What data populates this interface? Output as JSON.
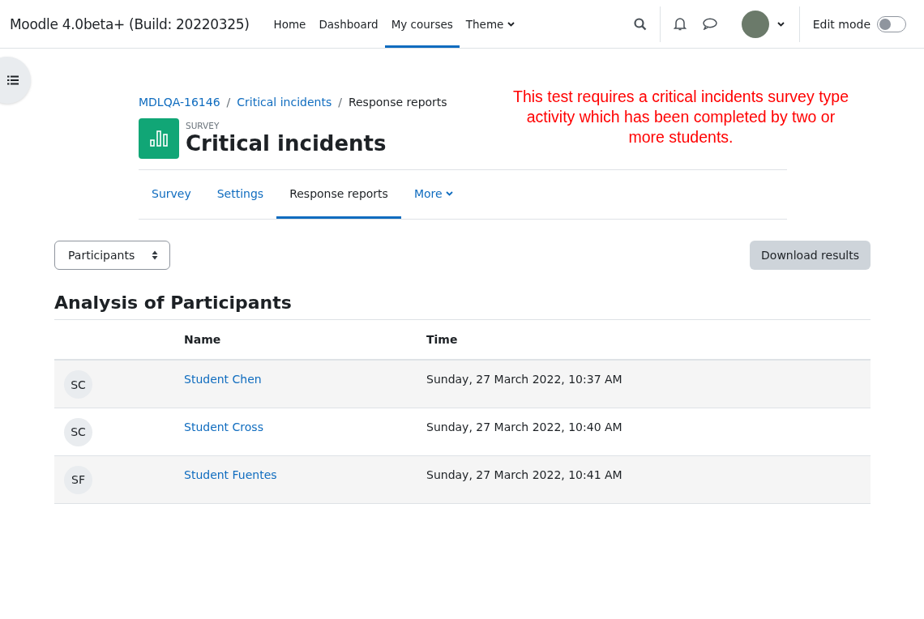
{
  "navbar": {
    "site_name": "Moodle 4.0beta+ (Build: 20220325)",
    "items": [
      {
        "label": "Home",
        "selected": false,
        "dropdown": false
      },
      {
        "label": "Dashboard",
        "selected": false,
        "dropdown": false
      },
      {
        "label": "My courses",
        "selected": true,
        "dropdown": false
      },
      {
        "label": "Theme",
        "selected": false,
        "dropdown": true
      }
    ],
    "edit_mode": {
      "label": "Edit mode",
      "on": false
    }
  },
  "note": "This test requires a critical incidents survey type activity which has been completed by two or more students.",
  "breadcrumb": [
    {
      "kind": "link",
      "label": "MDLQA-16146"
    },
    {
      "kind": "separator",
      "label": "/"
    },
    {
      "kind": "link",
      "label": "Critical incidents"
    },
    {
      "kind": "separator",
      "label": "/"
    },
    {
      "kind": "current",
      "label": "Response reports"
    }
  ],
  "activity": {
    "type_label": "SURVEY",
    "title": "Critical incidents"
  },
  "tabs": [
    {
      "label": "Survey",
      "selected": false,
      "dropdown": false
    },
    {
      "label": "Settings",
      "selected": false,
      "dropdown": false
    },
    {
      "label": "Response reports",
      "selected": true,
      "dropdown": false
    },
    {
      "label": "More",
      "selected": false,
      "dropdown": true
    }
  ],
  "report_select": {
    "value": "Participants"
  },
  "download_button": "Download results",
  "section_title": "Analysis of Participants",
  "table": {
    "columns": [
      "Name",
      "Time"
    ],
    "rows": [
      {
        "initials": "SC",
        "name": "Student Chen",
        "time": "Sunday, 27 March 2022, 10:37 AM"
      },
      {
        "initials": "SC",
        "name": "Student Cross",
        "time": "Sunday, 27 March 2022, 10:40 AM"
      },
      {
        "initials": "SF",
        "name": "Student Fuentes",
        "time": "Sunday, 27 March 2022, 10:41 AM"
      }
    ]
  }
}
